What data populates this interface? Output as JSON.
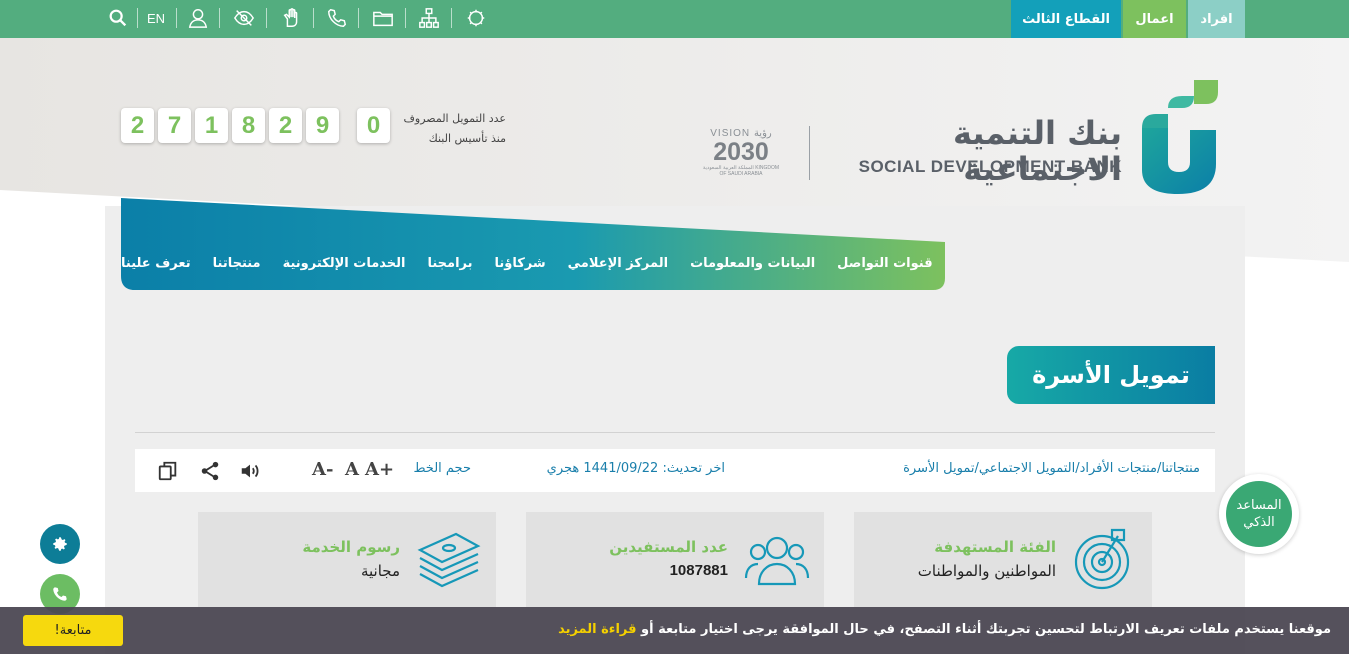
{
  "topbar": {
    "tabs": [
      {
        "label": "القطاع الثالث"
      },
      {
        "label": "اعمال"
      },
      {
        "label": "افراد"
      }
    ],
    "lang_label": "EN",
    "tools": [
      "search-icon",
      "user-icon",
      "eye-slash-icon",
      "sign-language-icon",
      "phone-icon",
      "folder-icon",
      "sitemap-icon",
      "national-emblem-icon"
    ]
  },
  "header": {
    "logo_ar": "بنك التنمية الاجتماعية",
    "logo_en": "SOCIAL DEVELOPMENT BANK",
    "vision_top": "VISION رؤية",
    "vision_year": "2030",
    "vision_sub": "المملكة العربية السعودية KINGDOM OF SAUDI ARABIA",
    "counter_label_1": "عدد التمويل المصروف",
    "counter_label_2": "منذ تأسيس البنك",
    "counter_digits": [
      "2",
      "7",
      "1",
      "8",
      "2",
      "9",
      "0"
    ]
  },
  "nav": {
    "items": [
      "تعرف علينا",
      "منتجاتنا",
      "الخدمات الإلكترونية",
      "برامجنا",
      "شركاؤنا",
      "المركز الإعلامي",
      "البيانات والمعلومات",
      "قنوات التواصل"
    ]
  },
  "page": {
    "title": "تمويل الأسرة",
    "breadcrumb": "منتجاتنا/منتجات الأفراد/التمويل الاجتماعي/تمويل الأسرة",
    "updated": "اخر تحديث: 1441/09/22 هجري",
    "font_size_label": "حجم الخط",
    "font_increase": "A+",
    "font_normal": "A",
    "font_decrease": "A-"
  },
  "cards": [
    {
      "title": "الفئة المستهدفة",
      "value": "المواطنين والمواطنات",
      "icon": "target-icon"
    },
    {
      "title": "عدد المستفيدين",
      "value": "1087881",
      "icon": "users-group-icon"
    },
    {
      "title": "رسوم الخدمة",
      "value": "مجانية",
      "icon": "money-stack-icon"
    }
  ],
  "assistant": {
    "line1": "المساعد",
    "line2": "الذكي"
  },
  "cookie": {
    "text": "موقعنا يستخدم ملفات تعريف الارتباط لتحسين تجربتك أثناء التصفح، في حال الموافقة يرجى اختيار متابعة أو",
    "link": "قراءة المزيد",
    "button": "متابعة!"
  },
  "colors": {
    "topbar": "#53ad7f",
    "accent_green": "#7dc15e",
    "accent_teal": "#13a0ba",
    "link_blue": "#1a7fab"
  }
}
